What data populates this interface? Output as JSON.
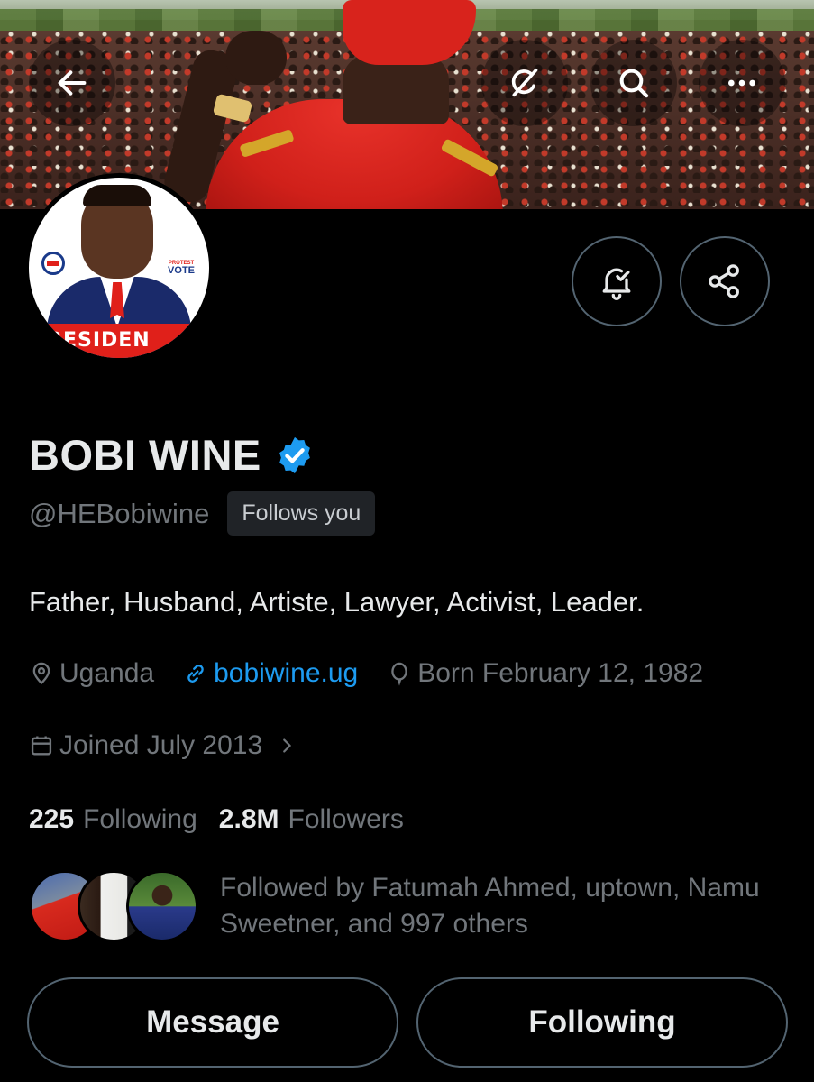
{
  "profile": {
    "name": "BOBI WINE",
    "handle": "@HEBobiwine",
    "follows_you": "Follows you",
    "bio": "Father, Husband, Artiste, Lawyer, Activist, Leader.",
    "location": "Uganda",
    "website": "bobiwine.ug",
    "birthday": "Born February 12, 1982",
    "joined": "Joined July 2013",
    "avatar_banner_text": "RESIDEN",
    "avatar_vote_text": "VOTE",
    "avatar_vote_small": "PROTEST"
  },
  "stats": {
    "following_count": "225",
    "following_label": "Following",
    "followers_count": "2.8M",
    "followers_label": "Followers"
  },
  "followed_by": {
    "text": "Followed by Fatumah Ahmed, uptown, Namu Sweetner, and 997 others"
  },
  "actions": {
    "message": "Message",
    "following": "Following"
  },
  "icons": {
    "top_left": "back-arrow-icon",
    "top_right": [
      "grok-icon",
      "search-icon",
      "more-icon"
    ],
    "profile_actions": [
      "notification-bell-icon",
      "share-icon"
    ],
    "verified": "verified-badge-icon"
  },
  "colors": {
    "background": "#000000",
    "text_primary": "#e7e9ea",
    "text_secondary": "#71767b",
    "link": "#1d9bf0",
    "verified": "#1d9bf0",
    "border": "#536471"
  }
}
